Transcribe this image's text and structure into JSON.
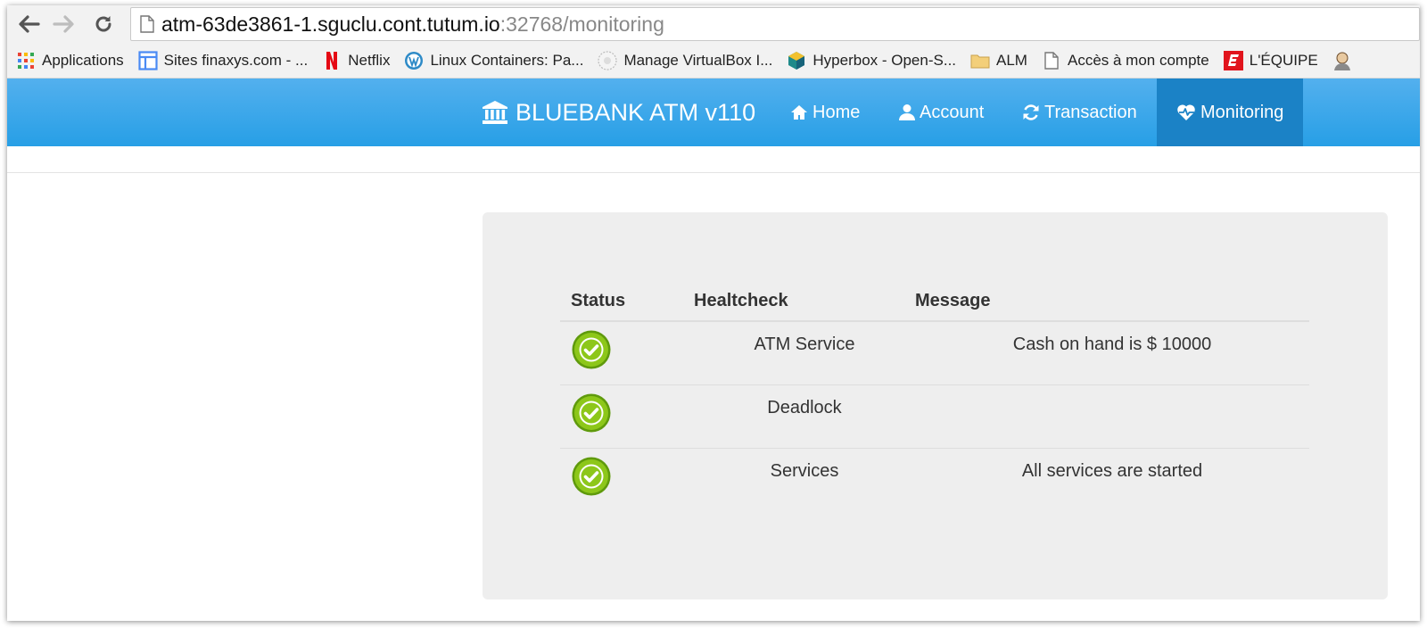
{
  "browser": {
    "url_host": "atm-63de3861-1.sguclu.cont.tutum.io",
    "url_path": ":32768/monitoring",
    "bookmarks": [
      {
        "label": "Applications",
        "icon": "apps-grid-icon"
      },
      {
        "label": "Sites finaxys.com - ...",
        "icon": "sites-icon"
      },
      {
        "label": "Netflix",
        "icon": "netflix-icon"
      },
      {
        "label": "Linux Containers: Pa...",
        "icon": "wordpress-icon"
      },
      {
        "label": "Manage VirtualBox I...",
        "icon": "virtualbox-icon"
      },
      {
        "label": "Hyperbox - Open-S...",
        "icon": "hyperbox-icon"
      },
      {
        "label": "ALM",
        "icon": "folder-icon"
      },
      {
        "label": "Accès à mon compte",
        "icon": "page-icon"
      },
      {
        "label": "L'ÉQUIPE",
        "icon": "lequipe-icon"
      }
    ]
  },
  "navbar": {
    "brand": "BLUEBANK ATM v110",
    "items": [
      {
        "label": "Home",
        "icon": "home-icon"
      },
      {
        "label": "Account",
        "icon": "user-icon"
      },
      {
        "label": "Transaction",
        "icon": "refresh-icon"
      },
      {
        "label": "Monitoring",
        "icon": "heartbeat-icon",
        "active": true
      }
    ]
  },
  "monitoring": {
    "headers": {
      "status": "Status",
      "healthcheck": "Healtcheck",
      "message": "Message"
    },
    "rows": [
      {
        "status": "ok",
        "healthcheck": "ATM Service",
        "message": "Cash on hand is $ 10000"
      },
      {
        "status": "ok",
        "healthcheck": "Deadlock",
        "message": ""
      },
      {
        "status": "ok",
        "healthcheck": "Services",
        "message": "All services are started"
      }
    ]
  },
  "colors": {
    "navbar": "#279fe6",
    "navbar_active": "#1b82c6",
    "panel": "#eeeeee",
    "status_ok": "#7bbf12"
  }
}
